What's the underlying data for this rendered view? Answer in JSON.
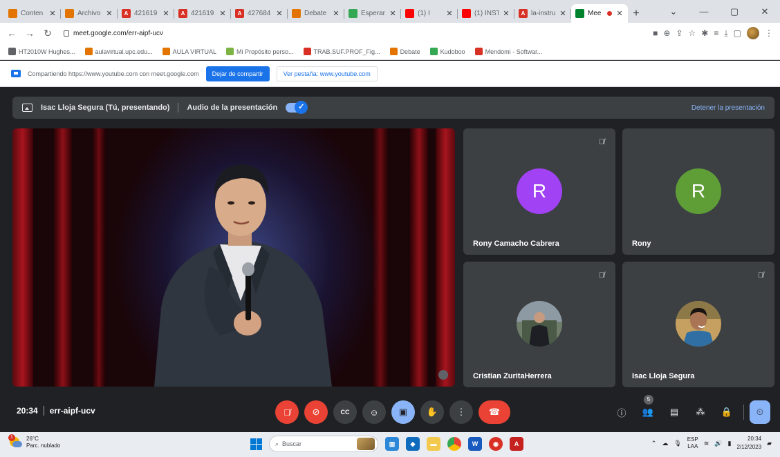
{
  "browser": {
    "tabs": [
      {
        "title": "Conten",
        "color": "#e37400",
        "letter": ""
      },
      {
        "title": "Archivo",
        "color": "#e37400",
        "letter": ""
      },
      {
        "title": "421619",
        "color": "#d93025",
        "letter": "A"
      },
      {
        "title": "421619",
        "color": "#d93025",
        "letter": "A"
      },
      {
        "title": "427684",
        "color": "#d93025",
        "letter": "A"
      },
      {
        "title": "Debate",
        "color": "#e37400",
        "letter": ""
      },
      {
        "title": "Esperan",
        "color": "#34a853",
        "letter": ""
      },
      {
        "title": "(1) I",
        "color": "#ff0000",
        "letter": ""
      },
      {
        "title": "(1) INST",
        "color": "#ff0000",
        "letter": ""
      },
      {
        "title": "la-instru",
        "color": "#d93025",
        "letter": "A"
      },
      {
        "title": "Mee",
        "color": "#00832d",
        "letter": "",
        "active": true
      }
    ],
    "new_tab": "+",
    "url": "meet.google.com/err-aipf-ucv",
    "bookmarks": [
      {
        "label": "HT2010W Hughes...",
        "color": "#5f6368"
      },
      {
        "label": "aulavirtual.upc.edu...",
        "color": "#e37400"
      },
      {
        "label": "AULA VIRTUAL",
        "color": "#e37400"
      },
      {
        "label": "Mi Propósito perso...",
        "color": "#7cb342"
      },
      {
        "label": "TRAB.SUF.PROF_Fig...",
        "color": "#d93025"
      },
      {
        "label": "Debate",
        "color": "#e37400"
      },
      {
        "label": "Kudoboo",
        "color": "#34a853"
      },
      {
        "label": "Mendomi - Softwar...",
        "color": "#d93025"
      }
    ]
  },
  "infobar": {
    "text": "Compartiendo https://www.youtube.com con meet.google.com",
    "stop_label": "Dejar de compartir",
    "view_label": "Ver pestaña: www.youtube.com"
  },
  "meet": {
    "presenter_text": "Isac Lloja Segura (Tú, presentando)",
    "audio_label": "Audio de la presentación",
    "stop_presenting": "Detener la presentación",
    "participants": [
      {
        "name": "Rony Camacho Cabrera",
        "initial": "R",
        "avatar_color": "#a142f4"
      },
      {
        "name": "Rony",
        "initial": "R",
        "avatar_color": "#5f9e37"
      },
      {
        "name": "Cristian ZuritaHerrera",
        "initial": ""
      },
      {
        "name": "Isac Lloja Segura",
        "initial": ""
      }
    ],
    "time": "20:34",
    "meeting_code": "err-aipf-ucv",
    "participant_count": "5"
  },
  "taskbar": {
    "weather_temp": "26°C",
    "weather_desc": "Parc. nublado",
    "weather_alert": "1",
    "search_placeholder": "Buscar",
    "lang_top": "ESP",
    "lang_bottom": "LAA",
    "clock_time": "20:34",
    "clock_date": "2/12/2023"
  }
}
